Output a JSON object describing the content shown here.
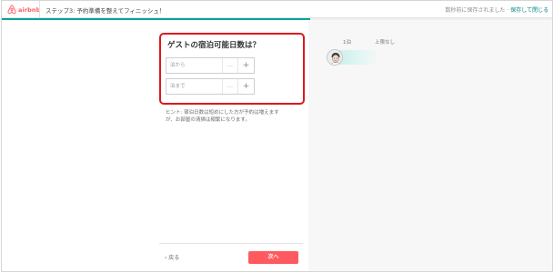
{
  "header": {
    "logo_text": "airbnb",
    "step_title": "ステップ3: 予約準備を整えてフィニッシュ！",
    "save_status": "数秒前に保存されました ·",
    "save_exit": "保存して閉じる"
  },
  "progress": {
    "fraction": 0.56
  },
  "card": {
    "title": "ゲストの宿泊可能日数は？",
    "min_nights": {
      "placeholder": "泊から",
      "minus": "—",
      "plus": "+"
    },
    "max_nights": {
      "placeholder": "泊まで",
      "minus": "—",
      "plus": "+"
    }
  },
  "hint": "ヒント: 宿泊日数は短めにした方が予約は増えますが、お部屋の清掃は頻繁になります。",
  "footer": {
    "back_label": "‹ 戻る",
    "next_label": "次へ"
  },
  "preview": {
    "min_label": "1泊",
    "max_label": "上限なし"
  },
  "colors": {
    "brand": "#ff5a5f",
    "teal": "#00a699",
    "highlight": "#e0171b"
  }
}
